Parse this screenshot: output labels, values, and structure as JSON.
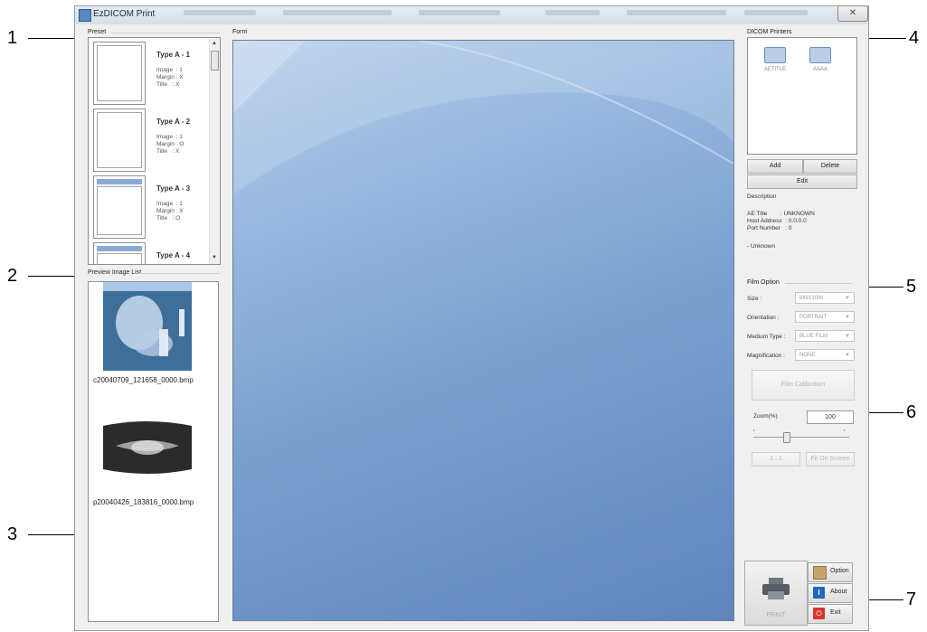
{
  "window": {
    "title": "EzDICOM Print",
    "close_glyph": "✕"
  },
  "callouts": [
    "1",
    "2",
    "3",
    "4",
    "5",
    "6",
    "7"
  ],
  "preset": {
    "label": "Preset",
    "items": [
      {
        "name": "Type A - 1",
        "meta": "Image  : 1\nMargin : X\nTitle   : X"
      },
      {
        "name": "Type A - 2",
        "meta": "Image  : 1\nMargin : O\nTitle   : X"
      },
      {
        "name": "Type A - 3",
        "meta": "Image  : 1\nMargin : X\nTitle   : O"
      },
      {
        "name": "Type A - 4",
        "meta": ""
      }
    ]
  },
  "preview": {
    "label": "Preview Image List",
    "images": [
      {
        "caption": "c20040709_121658_0000.bmp",
        "kind": "cephalometric-xray"
      },
      {
        "caption": "p20040426_183816_0000.bmp",
        "kind": "panoramic-xray"
      }
    ]
  },
  "form": {
    "label": "Form"
  },
  "printers": {
    "label": "DICOM Printers",
    "items": [
      {
        "name": "AETITLE"
      },
      {
        "name": "AAAA"
      }
    ],
    "buttons": {
      "add": "Add",
      "delete": "Delete",
      "edit": "Edit"
    },
    "description_label": "Description",
    "details": "AE Title        : UNKNOWN\nHost Address  : 0.0.0.0\nPort Number   : 0",
    "note": "- Unknown"
  },
  "film": {
    "label": "Film Option",
    "size_label": "Size :",
    "size_value": "8INX10IN",
    "orientation_label": "Orientation :",
    "orientation_value": "PORTRAIT",
    "medium_label": "Medium Type :",
    "medium_value": "BLUE FILM",
    "magnification_label": "Magnification :",
    "magnification_value": "NONE",
    "calibration_button": "Film Calibration"
  },
  "zoom": {
    "label": "Zoom(%)",
    "value": "100",
    "one_to_one": "1 : 1",
    "fit_screen": "Fit On Screen"
  },
  "actions": {
    "print": "PRINT",
    "option": "Option",
    "about": "About",
    "exit": "Exit"
  },
  "colors": {
    "accent_blue": "#6c93c9",
    "form_bg": "#7b9fcf",
    "exit_red": "#d9362b",
    "info_blue": "#1f66c1"
  }
}
